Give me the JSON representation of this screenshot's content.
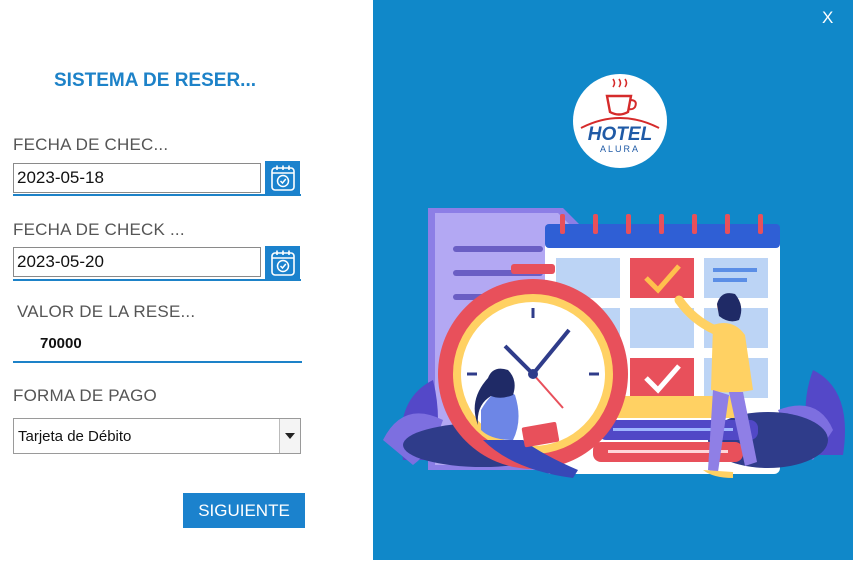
{
  "form": {
    "title": "SISTEMA DE RESER...",
    "checkin_label": "FECHA DE CHEC...",
    "checkin_value": "2023-05-18",
    "checkout_label": "FECHA DE CHECK ...",
    "checkout_value": "2023-05-20",
    "value_label": "VALOR DE LA RESE...",
    "value_amount": "70000",
    "payment_label": "FORMA DE PAGO",
    "payment_selected": "Tarjeta de Débito",
    "next_label": "SIGUIENTE"
  },
  "window": {
    "close_label": "X"
  },
  "logo": {
    "line1": "HOTEL",
    "line2": "ALURA"
  },
  "colors": {
    "accent": "#1b82cd",
    "panel": "#1088c9",
    "logo_red": "#d52b2b"
  },
  "icons": [
    "calendar-check-icon",
    "dropdown-arrow-icon",
    "coffee-cup-icon"
  ]
}
